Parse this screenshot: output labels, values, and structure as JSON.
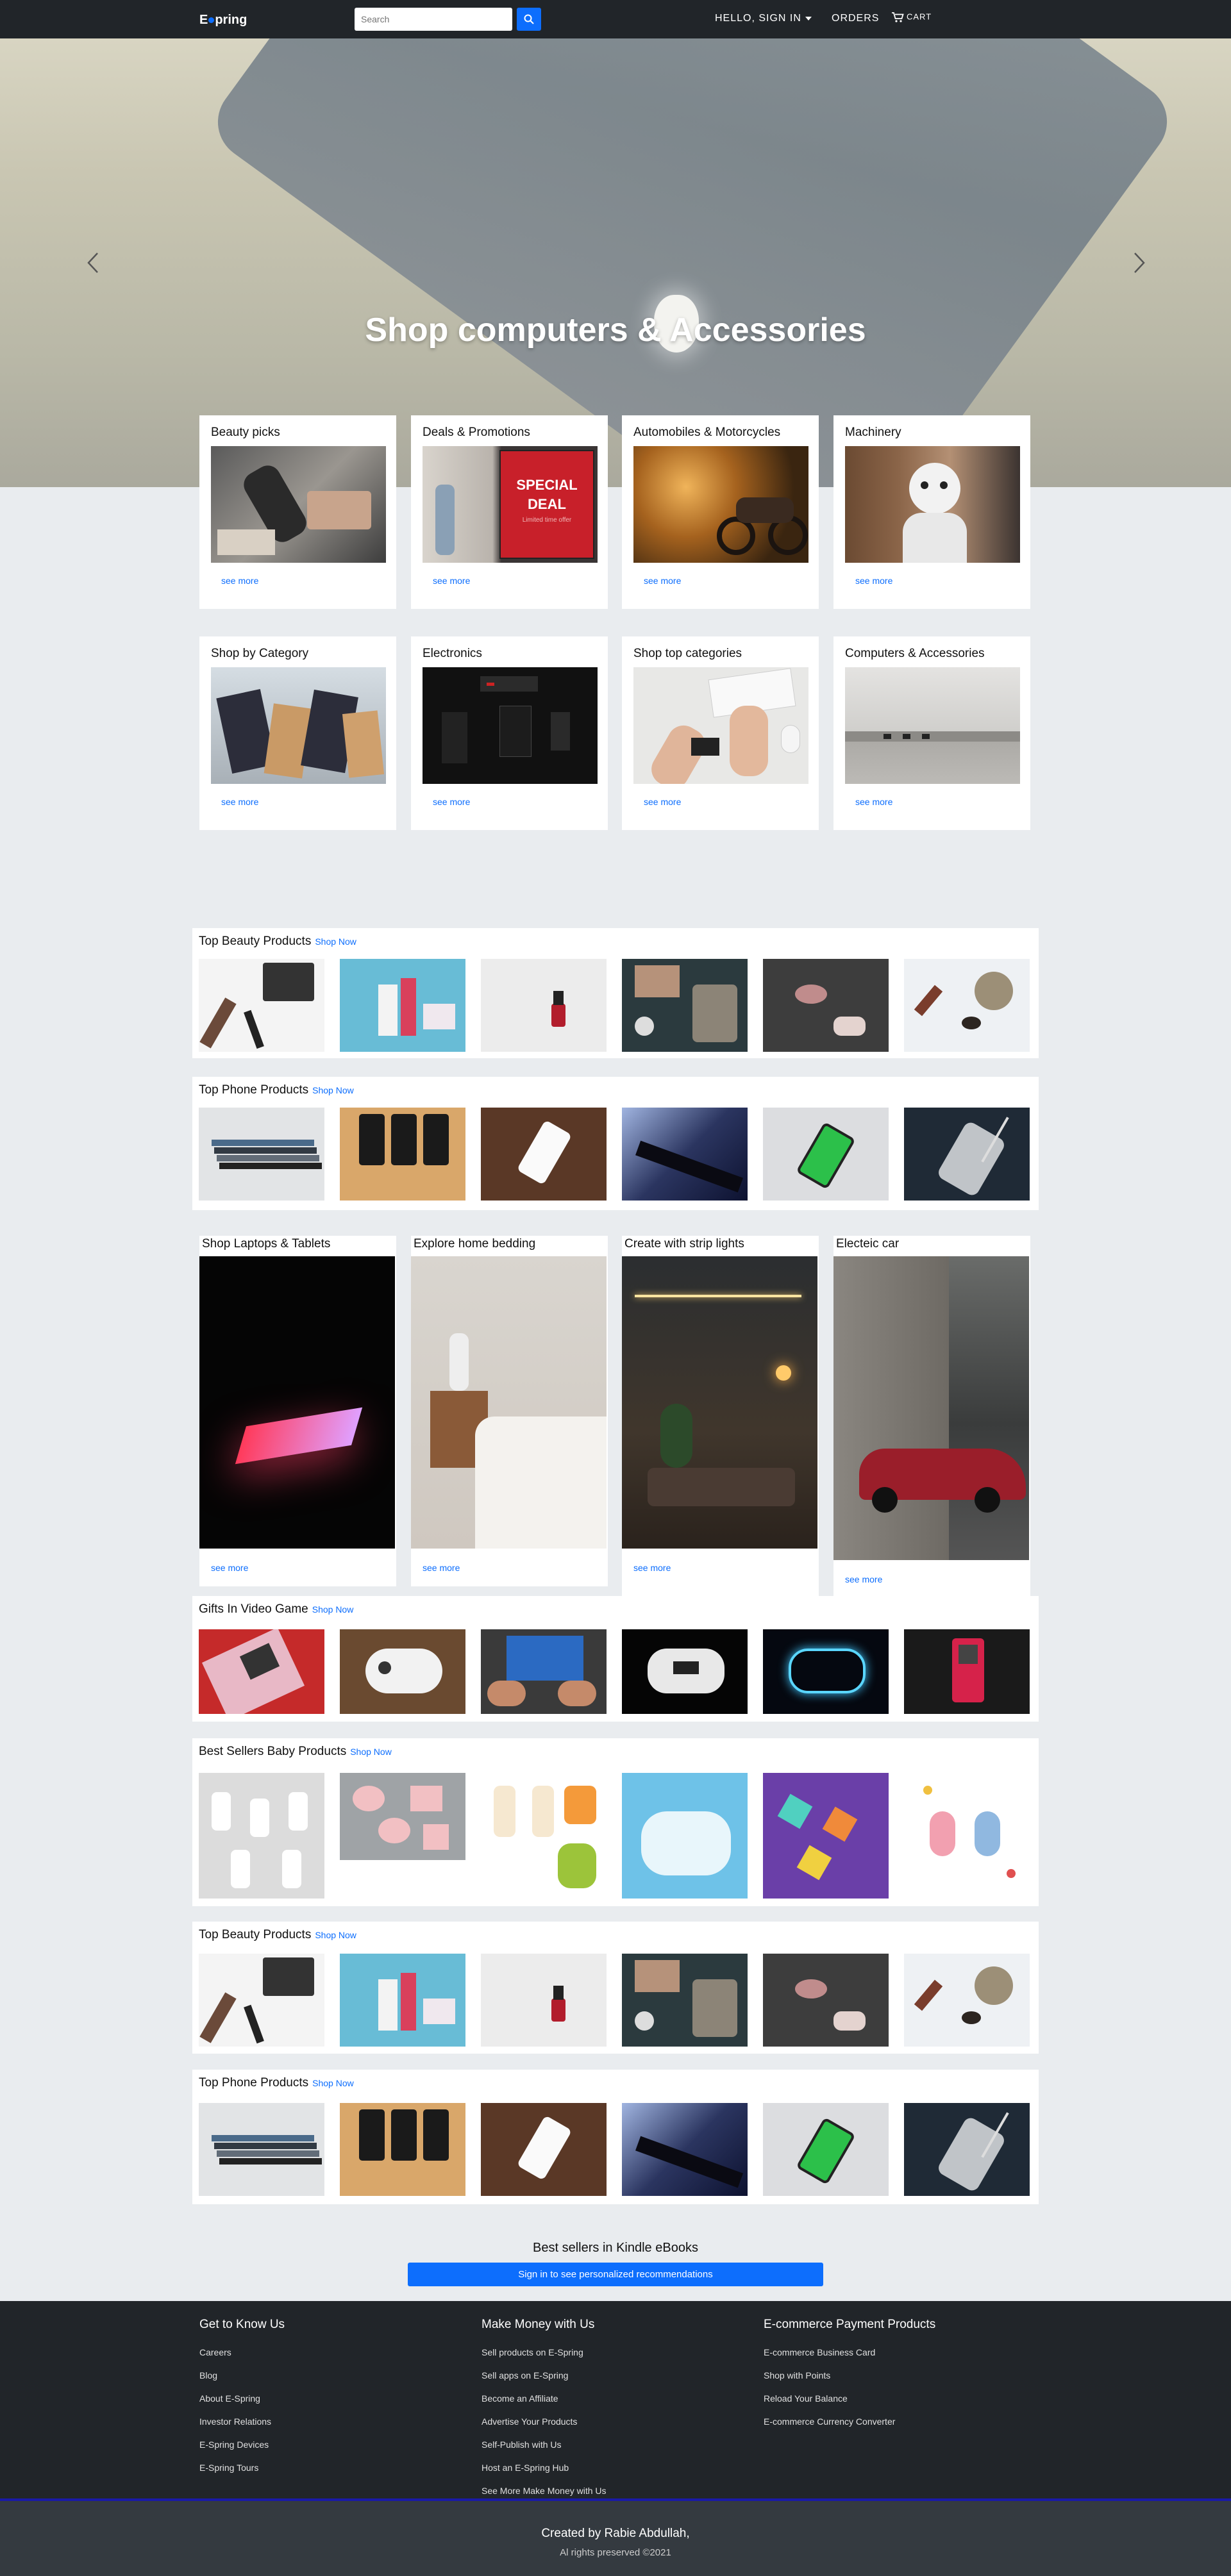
{
  "nav": {
    "logo_start": "E",
    "logo_end": "pring",
    "search_placeholder": "Search",
    "sign_in": "HELLO, SIGN IN",
    "orders": "ORDERS",
    "cart": "CART"
  },
  "hero": {
    "title": "Shop computers & Accessories"
  },
  "cards": [
    {
      "title": "Beauty picks",
      "link": "see more"
    },
    {
      "title": "Deals & Promotions",
      "link": "see more",
      "img_text_1": "SPECIAL",
      "img_text_2": "DEAL",
      "img_text_3": "Limited time offer"
    },
    {
      "title": "Automobiles & Motorcycles",
      "link": "see more"
    },
    {
      "title": "Machinery",
      "link": "see more"
    },
    {
      "title": "Shop by Category",
      "link": "see more"
    },
    {
      "title": "Electronics",
      "link": "see more"
    },
    {
      "title": "Shop top categories",
      "link": "see more"
    },
    {
      "title": "Computers & Accessories",
      "link": "see more"
    }
  ],
  "rows": {
    "beauty_1": {
      "title": "Top Beauty Products",
      "link": "Shop Now"
    },
    "phone_1": {
      "title": "Top Phone Products",
      "link": "Shop Now"
    },
    "games": {
      "title": "Gifts In Video Game",
      "link": "Shop Now"
    },
    "baby": {
      "title": "Best Sellers Baby Products",
      "link": "Shop Now"
    },
    "beauty_2": {
      "title": "Top Beauty Products",
      "link": "Shop Now"
    },
    "phone_2": {
      "title": "Top Phone Products",
      "link": "Shop Now"
    }
  },
  "tall_cards": [
    {
      "title": "Shop Laptops & Tablets",
      "link": "see more"
    },
    {
      "title": "Explore home bedding",
      "link": "see more"
    },
    {
      "title": "Create with strip lights",
      "link": "see more"
    },
    {
      "title": "Electeic car",
      "link": "see more"
    }
  ],
  "kindle": {
    "title": "Best sellers in Kindle eBooks",
    "button": "Sign in to see personalized recommendations"
  },
  "footer": {
    "col1": {
      "title": "Get to Know Us",
      "links": [
        "Careers",
        "Blog",
        "About E-Spring",
        "Investor Relations",
        "E-Spring Devices",
        "E-Spring Tours"
      ]
    },
    "col2": {
      "title": "Make Money with Us",
      "links": [
        "Sell products on E-Spring",
        "Sell apps on E-Spring",
        "Become an Affiliate",
        "Advertise Your Products",
        "Self-Publish with Us",
        "Host an E-Spring Hub",
        "See More Make Money with Us"
      ]
    },
    "col3": {
      "title": "E-commerce Payment Products",
      "links": [
        "E-commerce Business Card",
        "Shop with Points",
        "Reload Your Balance",
        "E-commerce Currency Converter"
      ]
    }
  },
  "copyright": {
    "name": "Created by Rabie Abdullah,",
    "rights": "Al rights preserved ©2021"
  },
  "colors": {
    "accent": "#0d6efd",
    "navbar": "#212529",
    "page_bg": "#e9ecef"
  }
}
